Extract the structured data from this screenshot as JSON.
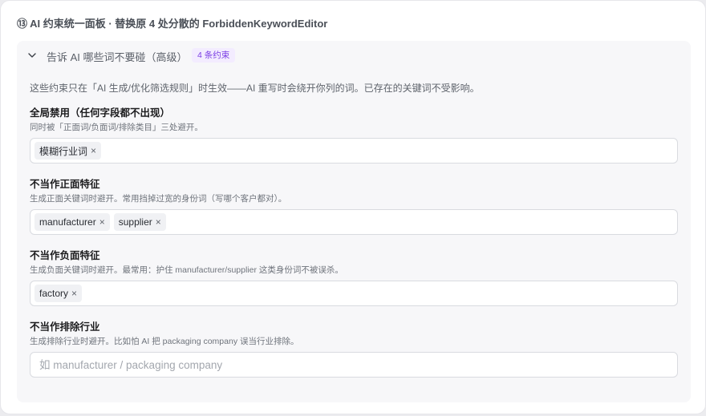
{
  "section": {
    "title": "⑬ AI 约束统一面板 · 替换原 4 处分散的 ForbiddenKeywordEditor"
  },
  "panel": {
    "title": "告诉 AI 哪些词不要碰（高级）",
    "badge": "4 条约束",
    "intro": "这些约束只在「AI 生成/优化筛选规则」时生效——AI 重写时会绕开你列的词。已存在的关键词不受影响。"
  },
  "groups": [
    {
      "label": "全局禁用（任何字段都不出现）",
      "hint": "同时被「正面词/负面词/排除类目」三处避开。",
      "tags": [
        "模糊行业词"
      ],
      "placeholder": ""
    },
    {
      "label": "不当作正面特征",
      "hint": "生成正面关键词时避开。常用挡掉过宽的身份词（写哪个客户都对）。",
      "tags": [
        "manufacturer",
        "supplier"
      ],
      "placeholder": ""
    },
    {
      "label": "不当作负面特征",
      "hint": "生成负面关键词时避开。最常用：护住 manufacturer/supplier 这类身份词不被误杀。",
      "tags": [
        "factory"
      ],
      "placeholder": ""
    },
    {
      "label": "不当作排除行业",
      "hint": "生成排除行业时避开。比如怕 AI 把 packaging company 误当行业排除。",
      "tags": [],
      "placeholder": "如 manufacturer / packaging company"
    }
  ],
  "icons": {
    "collapse": "chevron-down-icon",
    "remove_tag": "close-icon",
    "remove_glyph": "×"
  },
  "colors": {
    "accent": "#7b3fe4",
    "badge_bg": "#f3ecff"
  }
}
